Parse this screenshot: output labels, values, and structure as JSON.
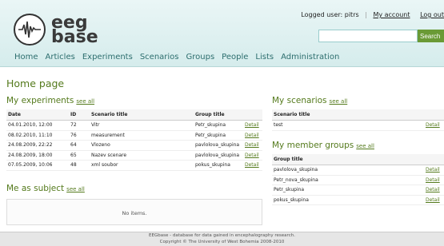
{
  "logo": {
    "line1": "eeg",
    "line2": "base"
  },
  "user": {
    "logged_text": "Logged user: pitrs",
    "account_link": "My account",
    "logout_link": "Log out"
  },
  "search": {
    "button_label": "Search",
    "value": ""
  },
  "nav": [
    "Home",
    "Articles",
    "Experiments",
    "Scenarios",
    "Groups",
    "People",
    "Lists",
    "Administration"
  ],
  "page_title": "Home page",
  "experiments": {
    "title": "My experiments",
    "see_all": "see all",
    "headers": [
      "Date",
      "ID",
      "Scenario title",
      "Group title",
      ""
    ],
    "rows": [
      [
        "04.01.2010, 12:00",
        "72",
        "Vitr",
        "Petr_skupina",
        "Detail"
      ],
      [
        "08.02.2010, 11:10",
        "76",
        "measurement",
        "Petr_skupina",
        "Detail"
      ],
      [
        "24.08.2009, 22:22",
        "64",
        "Vlozeno",
        "pavlolova_skupina",
        "Detail"
      ],
      [
        "24.08.2009, 18:00",
        "65",
        "Nazev scenare",
        "pavlolova_skupina",
        "Detail"
      ],
      [
        "07.05.2009, 10:06",
        "48",
        "xml soubor",
        "pokus_skupina",
        "Detail"
      ]
    ]
  },
  "subject": {
    "title": "Me as subject",
    "see_all": "see all",
    "empty_text": "No items."
  },
  "scenarios": {
    "title": "My scenarios",
    "see_all": "see all",
    "headers": [
      "Scenario title",
      ""
    ],
    "rows": [
      [
        "test",
        "Detail"
      ]
    ]
  },
  "member_groups": {
    "title": "My member groups",
    "see_all": "see all",
    "headers": [
      "Group title",
      ""
    ],
    "rows": [
      [
        "pavlolova_skupina",
        "Detail"
      ],
      [
        "Petr_nova_skupina",
        "Detail"
      ],
      [
        "Petr_skupina",
        "Detail"
      ],
      [
        "pokus_skupina",
        "Detail"
      ]
    ]
  },
  "footer": {
    "line1": "EEGbase - database for data gained in encephalography research.",
    "line2": "Copyright © The University of West Bohemia 2008-2010"
  },
  "colors": {
    "accent_green": "#547a1c",
    "nav_teal": "#2d6e6e",
    "search_green": "#6a9a35"
  }
}
